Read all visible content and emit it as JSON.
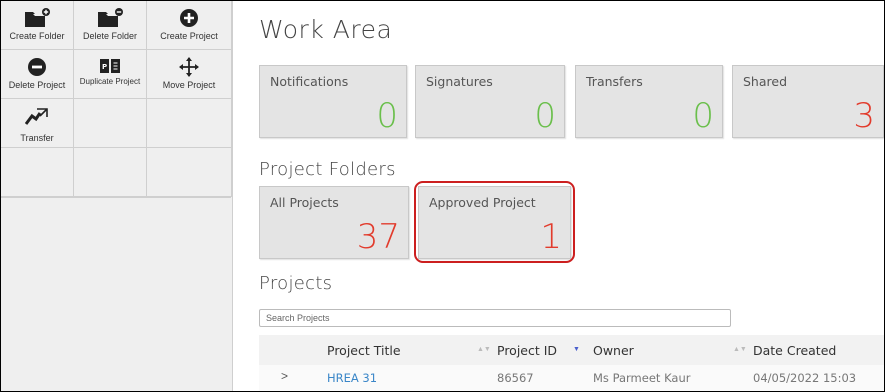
{
  "toolbar": {
    "items": [
      {
        "label": "Create Folder",
        "icon": "folder-plus-icon"
      },
      {
        "label": "Delete Folder",
        "icon": "folder-minus-icon"
      },
      {
        "label": "Create Project",
        "icon": "plus-circle-icon"
      },
      {
        "label": "Delete Project",
        "icon": "minus-circle-icon"
      },
      {
        "label": "Duplicate Project",
        "icon": "duplicate-icon"
      },
      {
        "label": "Move Project",
        "icon": "move-arrows-icon"
      },
      {
        "label": "Transfer",
        "icon": "transfer-icon"
      }
    ]
  },
  "work_area": {
    "title": "Work Area",
    "cards": [
      {
        "label": "Notifications",
        "value": "0"
      },
      {
        "label": "Signatures",
        "value": "0"
      },
      {
        "label": "Transfers",
        "value": "0"
      },
      {
        "label": "Shared",
        "value": "3"
      }
    ]
  },
  "project_folders": {
    "title": "Project Folders",
    "cards": [
      {
        "label": "All Projects",
        "value": "37"
      },
      {
        "label": "Approved Project",
        "value": "1"
      }
    ]
  },
  "projects": {
    "title": "Projects",
    "search_placeholder": "Search Projects",
    "columns": [
      "Project Title",
      "Project ID",
      "Owner",
      "Date Created"
    ],
    "rows": [
      {
        "expander": ">",
        "title": "HREA 31",
        "id": "86567",
        "owner": "Ms Parmeet Kaur",
        "date": "04/05/2022 15:03"
      }
    ]
  },
  "colors": {
    "accent_green": "#6abf4b",
    "accent_red": "#e23b2c",
    "link_blue": "#3a86c8",
    "highlight": "#cc1f1f"
  }
}
